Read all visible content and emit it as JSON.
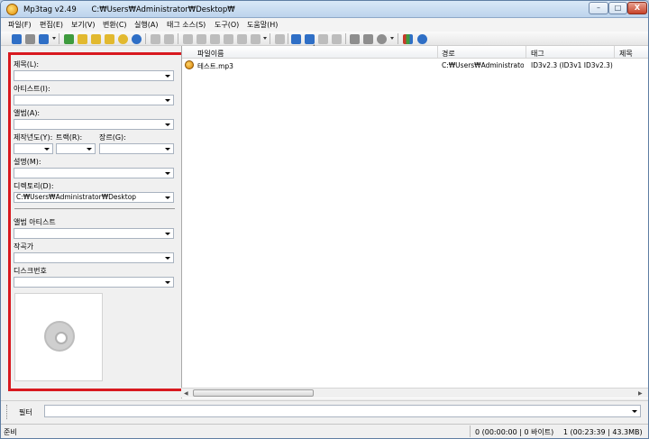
{
  "window": {
    "app": "Mp3tag v2.49",
    "path": "C:₩Users₩Administrator₩Desktop₩",
    "controls": {
      "minimize": "–",
      "maximize": "□",
      "close": "X"
    }
  },
  "menu": [
    "파일(F)",
    "편집(E)",
    "보기(V)",
    "변환(C)",
    "실행(A)",
    "태그 소스(S)",
    "도구(O)",
    "도움말(H)"
  ],
  "toolbar": {
    "icons": [
      "save-icon",
      "remove-tag-icon",
      "undo-icon",
      "change-directory-icon",
      "add-directory-icon",
      "open-folder-icon",
      "favorite-directory-icon",
      "star-icon",
      "refresh-icon",
      "tag-to-filename-icon",
      "filename-to-tag-icon",
      "text-file-icon",
      "convert-tag-icon",
      "case-icon",
      "wand-icon",
      "text-size-icon",
      "edit-icon",
      "export-icon",
      "playlist-icon",
      "options-icon",
      "help-icon"
    ],
    "colors": {
      "blue": "#2f6fc6",
      "green": "#3e9b3e",
      "yellow": "#e2b92f",
      "red": "#c73a2a",
      "gray": "#8e8e8e"
    }
  },
  "tag_panel": {
    "accent_border": "#d8191f",
    "title_label": "제목(L):",
    "artist_label": "아티스트(I):",
    "album_label": "앨범(A):",
    "year_label": "제작년도(Y):",
    "track_label": "트랙(R):",
    "genre_label": "장르(G):",
    "comment_label": "설명(M):",
    "directory_label": "디렉토리(D):",
    "directory_value": "C:₩Users₩Administrator₩Desktop",
    "album_artist_label": "앨범 아티스트",
    "composer_label": "작곡가",
    "disc_label": "디스크번호"
  },
  "file_list": {
    "columns": [
      "파일이름",
      "경로",
      "태그",
      "제목"
    ],
    "rows": [
      {
        "filename": "테스트.mp3",
        "path": "C:₩Users₩Administrato...",
        "tag": "ID3v2.3 (ID3v1 ID3v2.3)",
        "title": ""
      }
    ]
  },
  "filter": {
    "label": "필터",
    "value": ""
  },
  "status": {
    "ready": "준비",
    "selection": "0 (00:00:00 | 0 바이트)",
    "total": "1 (00:23:39 | 43.3MB)"
  }
}
